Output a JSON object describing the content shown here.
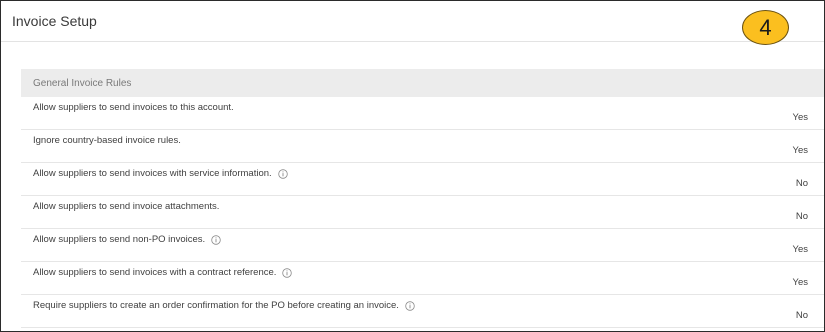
{
  "header": {
    "title": "Invoice Setup"
  },
  "step_badge": {
    "number": "4",
    "color": "#fbbf1f"
  },
  "section": {
    "title": "General Invoice Rules"
  },
  "rules": [
    {
      "label": "Allow suppliers to send invoices to this account.",
      "value": "Yes",
      "info": false
    },
    {
      "label": "Ignore country-based invoice rules.",
      "value": "Yes",
      "info": false
    },
    {
      "label": "Allow suppliers to send invoices with service information.",
      "value": "No",
      "info": true
    },
    {
      "label": "Allow suppliers to send invoice attachments.",
      "value": "No",
      "info": false
    },
    {
      "label": "Allow suppliers to send non-PO invoices.",
      "value": "Yes",
      "info": true
    },
    {
      "label": "Allow suppliers to send invoices with a contract reference.",
      "value": "Yes",
      "info": true
    },
    {
      "label": "Require suppliers to create an order confirmation for the PO before creating an invoice.",
      "value": "No",
      "info": true
    }
  ]
}
